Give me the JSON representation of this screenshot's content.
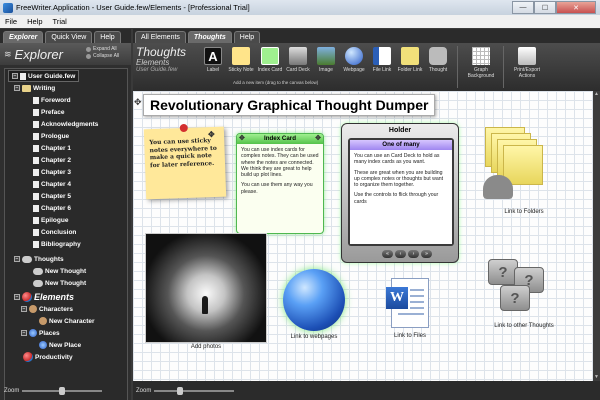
{
  "window": {
    "title": "FreeWriter.Application - User Guide.few/Elements - [Professional Trial]",
    "controls": {
      "minimize": "—",
      "maximize": "☐",
      "close": "✕"
    }
  },
  "menu": [
    "File",
    "Help",
    "Trial"
  ],
  "left_tabs": [
    "Explorer",
    "Quick View",
    "Help"
  ],
  "right_tabs": [
    "All Elements",
    "Thoughts",
    "Help"
  ],
  "explorer": {
    "title": "Explorer",
    "expand_all": "Expand All",
    "collapse_all": "Collapse All"
  },
  "tree": {
    "root": "User Guide.few",
    "writing": "Writing",
    "chapters": [
      "Foreword",
      "Preface",
      "Acknowledgments",
      "Prologue",
      "Chapter 1",
      "Chapter 2",
      "Chapter 3",
      "Chapter 4",
      "Chapter 5",
      "Chapter 6",
      "Epilogue",
      "Conclusion",
      "Bibliography"
    ],
    "thoughts": "Thoughts",
    "thought_items": [
      "New Thought",
      "New Thought"
    ],
    "elements": "Elements",
    "characters": "Characters",
    "new_character": "New Character",
    "places": "Places",
    "new_place": "New Place",
    "productivity": "Productivity"
  },
  "zoom": {
    "label": "Zoom",
    "left_level": 0.5,
    "canvas_level": 0.3
  },
  "ribbon": {
    "title": "Thoughts",
    "subtitle": "Elements",
    "file": "User Guide.few",
    "tools": [
      "Label",
      "Sticky Note",
      "Index Card",
      "Card Deck",
      "Image",
      "Webpage",
      "File Link",
      "Folder Link",
      "Thought"
    ],
    "hint": "Add a new item (drag to the canvas below)",
    "graph_label": "Graph",
    "graph_sub": "Background",
    "print_label": "Print/Export",
    "print_sub": "Actions"
  },
  "canvas": {
    "heading": "Revolutionary Graphical Thought Dumper",
    "sticky_text": "You can use sticky notes everywhere to make a quick note for later reference.",
    "index_card": {
      "title": "Index Card",
      "body1": "You can use index cards for complex notes. They can be used where the notes are connected. We think they are great to help build up plot lines.",
      "body2": "You can use them any way you please."
    },
    "holder": {
      "title": "Holder",
      "card_title": "One of many",
      "body1": "You can use an Card Deck to hold as many index cards as you want.",
      "body2": "These are great when you are building up complex notes or thoughts but want to organize them together.",
      "body3": "Use the controls to flick through your cards",
      "nav": [
        "«",
        "‹",
        "›",
        "»"
      ]
    },
    "captions": {
      "photos": "Add photos",
      "webpages": "Link to webpages",
      "files": "Link to Files",
      "folders": "Link to Folders",
      "thoughts": "Link to other Thoughts"
    }
  }
}
